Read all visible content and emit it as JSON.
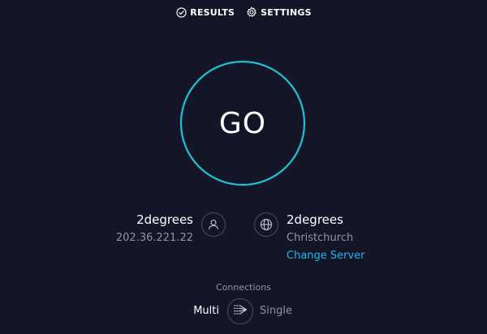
{
  "nav": {
    "results_label": "RESULTS",
    "settings_label": "SETTINGS"
  },
  "go_button": {
    "label": "GO"
  },
  "isp": {
    "name": "2degrees",
    "ip": "202.36.221.22"
  },
  "server": {
    "name": "2degrees",
    "location": "Christchurch",
    "change_label": "Change Server"
  },
  "connections": {
    "title": "Connections",
    "multi_label": "Multi",
    "single_label": "Single",
    "selected": "Multi"
  },
  "icons": {
    "results": "check-circle-icon",
    "settings": "gear-icon",
    "isp": "user-icon",
    "server": "globe-icon",
    "connections": "connections-icon"
  },
  "colors": {
    "background": "#141526",
    "accent_ring": "#27c3d8",
    "link": "#1cb8f0",
    "muted_text": "#9193a8",
    "icon_border": "#4a4c63"
  }
}
